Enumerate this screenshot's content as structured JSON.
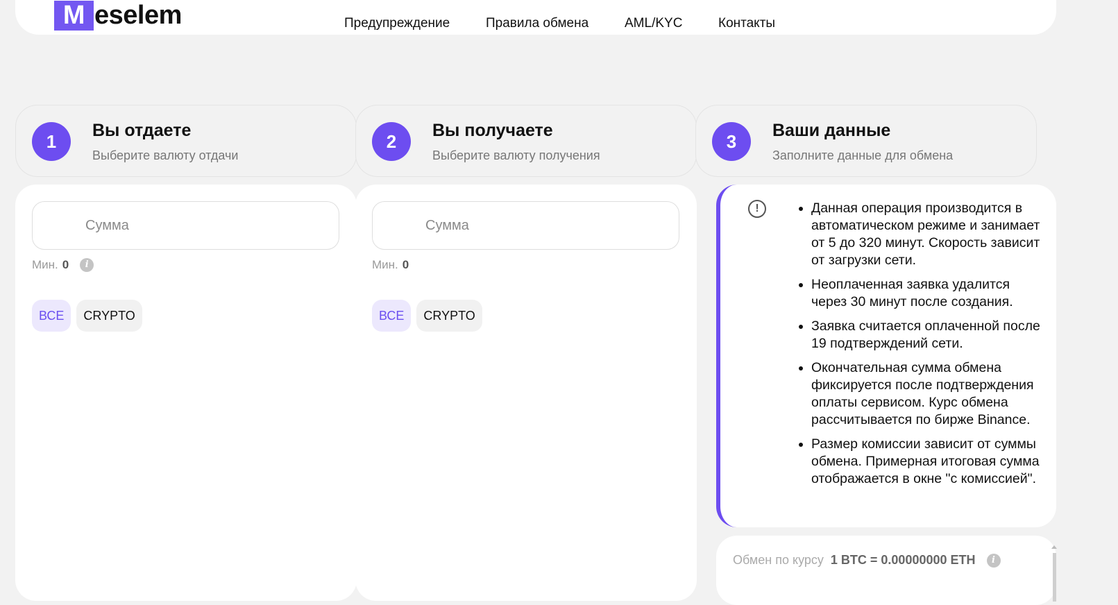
{
  "header": {
    "logo_letter": "M",
    "logo_rest": "eselem",
    "nav": [
      "Предупреждение",
      "Правила обмена",
      "AML/KYC",
      "Контакты"
    ]
  },
  "steps": [
    {
      "number": "1",
      "title": "Вы отдаете",
      "subtitle": "Выберите валюту отдачи"
    },
    {
      "number": "2",
      "title": "Вы получаете",
      "subtitle": "Выберите валюту получения"
    },
    {
      "number": "3",
      "title": "Ваши данные",
      "subtitle": "Заполните данные для обмена"
    }
  ],
  "give": {
    "amount_placeholder": "Сумма",
    "min_label": "Мин.",
    "min_value": "0",
    "filters": [
      "ВСЕ",
      "CRYPTO"
    ]
  },
  "receive": {
    "amount_placeholder": "Сумма",
    "min_label": "Мин.",
    "min_value": "0",
    "filters": [
      "ВСЕ",
      "CRYPTO"
    ]
  },
  "info": {
    "notes": [
      "Данная операция производится в автоматическом режиме и занимает от 5 до 320 минут. Скорость зависит от загрузки сети.",
      "Неоплаченная заявка удалится через 30 минут после создания.",
      "Заявка считается оплаченной после 19 подтверждений сети.",
      "Окончательная сумма обмена фиксируется после подтверждения оплаты сервисом. Курс обмена рассчитывается по бирже Binance.",
      "Размер комиссии зависит от суммы обмена. Примерная итоговая сумма отображается в окне \"с комиссией\"."
    ]
  },
  "rate": {
    "label": "Обмен по курсу",
    "value": "1 BTC = 0.00000000 ETH"
  },
  "colors": {
    "accent": "#6d4df0",
    "chip_active_bg": "#ece8fd",
    "background": "#f2f2f2"
  },
  "icons": {
    "info": "info-icon",
    "alert": "exclamation-circle-icon"
  }
}
